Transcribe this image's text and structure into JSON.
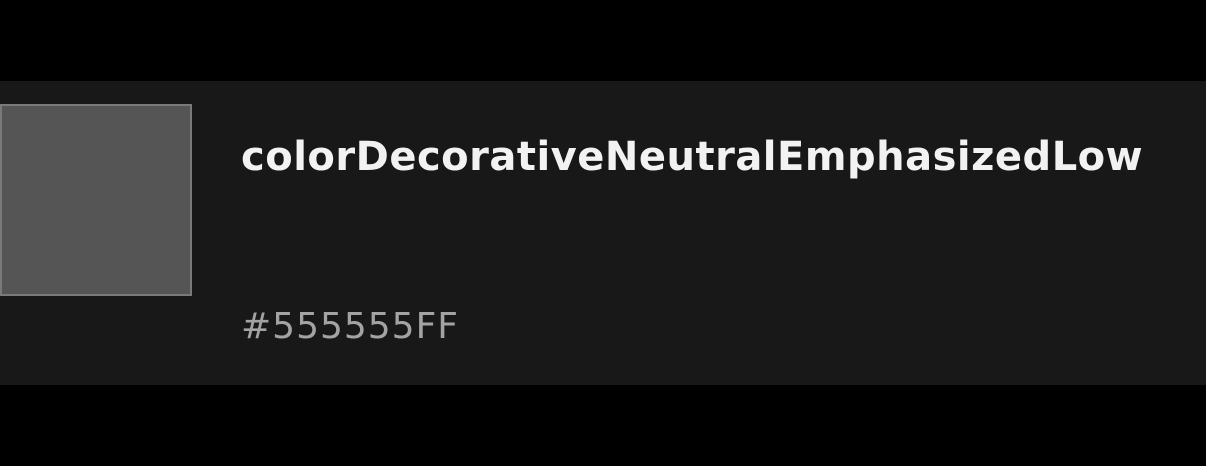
{
  "token": {
    "name": "colorDecorativeNeutralEmphasizedLow",
    "hex": "#555555FF",
    "swatch_color": "#555555"
  },
  "colors": {
    "page_background": "#000000",
    "card_background": "#181818",
    "name_text": "#f2f2f2",
    "hex_text": "#a3a3a3",
    "swatch_border": "#7a7a7a"
  }
}
